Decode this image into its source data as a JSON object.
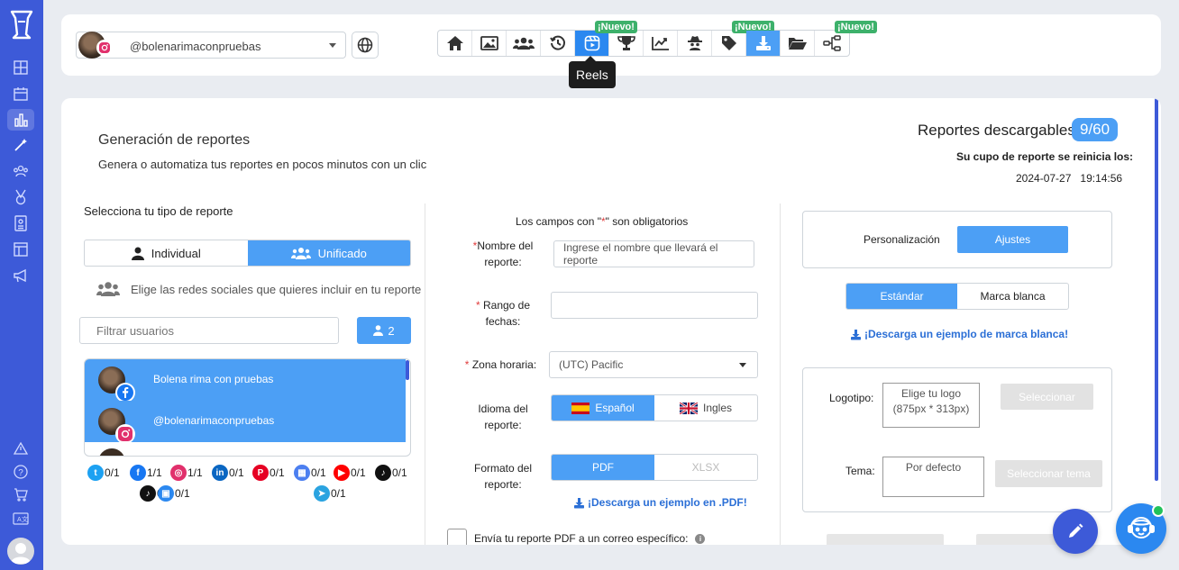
{
  "sidebar": {
    "items": [
      "dashboard-icon",
      "calendar-icon",
      "analytics-icon",
      "magic-icon",
      "users-icon",
      "medal-icon",
      "id-card-icon",
      "layout-icon",
      "megaphone-icon"
    ],
    "bottom_items": [
      "alert-icon",
      "help-icon",
      "cart-icon",
      "translate-icon"
    ]
  },
  "topbar": {
    "account_name": "@bolenarimaconpruebas",
    "tools": [
      {
        "name": "home",
        "badge": ""
      },
      {
        "name": "image",
        "badge": ""
      },
      {
        "name": "users",
        "badge": ""
      },
      {
        "name": "history",
        "badge": ""
      },
      {
        "name": "reels",
        "badge": "¡Nuevo!"
      },
      {
        "name": "trophy",
        "badge": ""
      },
      {
        "name": "chart",
        "badge": ""
      },
      {
        "name": "spy",
        "badge": ""
      },
      {
        "name": "tag",
        "badge": "¡Nuevo!"
      },
      {
        "name": "download",
        "badge": ""
      },
      {
        "name": "folder",
        "badge": ""
      },
      {
        "name": "flow",
        "badge": "¡Nuevo!"
      }
    ],
    "tooltip": "Reels"
  },
  "header": {
    "title": "Generación de reportes",
    "subtitle": "Genera o automatiza tus reportes en pocos minutos con un clic",
    "reports_label": "Reportes descargables:",
    "reports_count": "9/60",
    "reset_label": "Su cupo de reporte se reinicia los:",
    "reset_date": "2024-07-27",
    "reset_time": "19:14:56"
  },
  "left": {
    "title": "Selecciona tu tipo de reporte",
    "type_individual": "Individual",
    "type_unified": "Unificado",
    "hint": "Elige las redes sociales que quieres incluir en tu reporte",
    "filter_placeholder": "Filtrar usuarios",
    "selected_count": "2",
    "users": [
      {
        "name": "Bolena rima con pruebas",
        "network": "facebook"
      },
      {
        "name": "@bolenarimaconpruebas",
        "network": "instagram"
      }
    ],
    "networks": [
      {
        "name": "twitter",
        "count": "0/1",
        "color": "#1da1f2",
        "glyph": "t"
      },
      {
        "name": "facebook",
        "count": "1/1",
        "color": "#1877f2",
        "glyph": "f"
      },
      {
        "name": "instagram",
        "count": "1/1",
        "color": "#e1306c",
        "glyph": "◎"
      },
      {
        "name": "linkedin",
        "count": "0/1",
        "color": "#0a66c2",
        "glyph": "in"
      },
      {
        "name": "pinterest",
        "count": "0/1",
        "color": "#e60023",
        "glyph": "P"
      },
      {
        "name": "google-business",
        "count": "0/1",
        "color": "#4c7ff0",
        "glyph": "▦"
      },
      {
        "name": "youtube",
        "count": "0/1",
        "color": "#ff0000",
        "glyph": "▶"
      },
      {
        "name": "tiktok",
        "count": "0/1",
        "color": "#111111",
        "glyph": "♪"
      },
      {
        "name": "tiktok-business",
        "count": "0/1",
        "color": "#111111",
        "glyph": "♪"
      },
      {
        "name": "tiktok-ads",
        "count": "0/1",
        "color": "#2b88f0",
        "glyph": "▣"
      },
      {
        "name": "telegram",
        "count": "0/1",
        "color": "#2aa3e0",
        "glyph": "➤"
      }
    ]
  },
  "middle": {
    "required_note_pre": "Los campos con \"",
    "required_note_ast": "*",
    "required_note_post": "\" son obligatorios",
    "name_label": "Nombre del reporte:",
    "name_placeholder": "Ingrese el nombre que llevará el reporte",
    "range_label": "Rango de fechas:",
    "tz_label": "Zona horaria:",
    "tz_value": "(UTC) Pacific",
    "lang_label": "Idioma del reporte:",
    "lang_es": "Español",
    "lang_en": "Ingles",
    "format_label": "Formato del reporte:",
    "format_pdf": "PDF",
    "format_xlsx": "XLSX",
    "pdf_example": "¡Descarga un ejemplo en .PDF!",
    "email_label": "Envía tu reporte PDF a un correo específico:"
  },
  "right": {
    "tab_custom": "Personalización",
    "tab_settings": "Ajustes",
    "mode_standard": "Estándar",
    "mode_white": "Marca blanca",
    "white_example": "¡Descarga un ejemplo de marca blanca!",
    "logo_label": "Logotipo:",
    "logo_hint": "Elige tu logo (875px * 313px)",
    "logo_button": "Seleccionar",
    "theme_label": "Tema:",
    "theme_value": "Por defecto",
    "theme_button": "Seleccionar tema"
  },
  "colors": {
    "primary": "#4c9ff5",
    "sidebar": "#3d5ad8",
    "badge_new": "#3db16b"
  }
}
